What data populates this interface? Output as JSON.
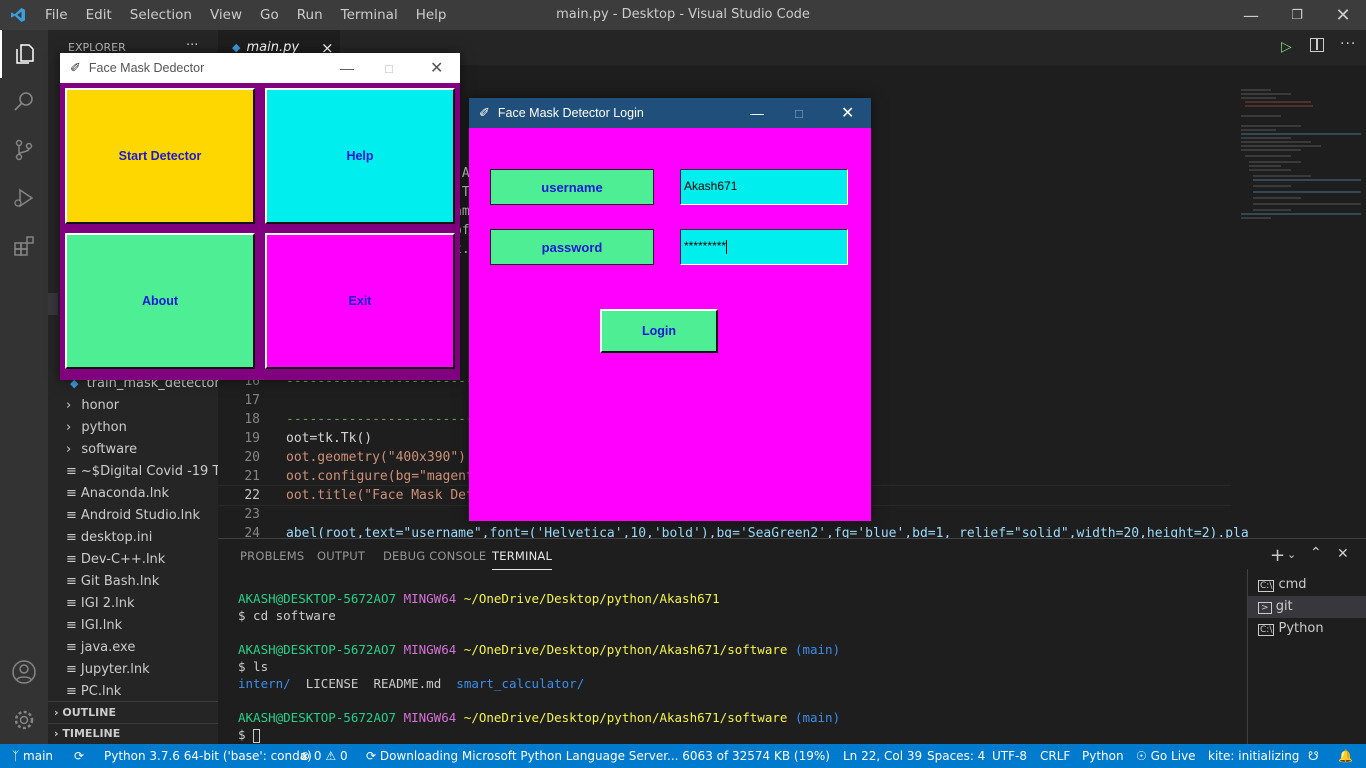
{
  "window": {
    "title": "main.py - Desktop - Visual Studio Code"
  },
  "menu": [
    "File",
    "Edit",
    "Selection",
    "View",
    "Go",
    "Run",
    "Terminal",
    "Help"
  ],
  "explorer": {
    "header": "EXPLORER",
    "more": "···"
  },
  "tab": {
    "label": "main.py",
    "close": "×"
  },
  "files": [
    {
      "label": "train_mask_detector....",
      "type": "py"
    },
    {
      "label": "honor",
      "type": "folder"
    },
    {
      "label": "python",
      "type": "folder"
    },
    {
      "label": "software",
      "type": "folder"
    },
    {
      "label": "~$Digital Covid -19 T...",
      "type": "file"
    },
    {
      "label": "Anaconda.lnk",
      "type": "file"
    },
    {
      "label": "Android Studio.lnk",
      "type": "file"
    },
    {
      "label": "desktop.ini",
      "type": "file"
    },
    {
      "label": "Dev-C++.lnk",
      "type": "file"
    },
    {
      "label": "Git Bash.lnk",
      "type": "file"
    },
    {
      "label": "IGI 2.lnk",
      "type": "file"
    },
    {
      "label": "IGI.lnk",
      "type": "file"
    },
    {
      "label": "java.exe",
      "type": "file"
    },
    {
      "label": "Jupyter.lnk",
      "type": "file"
    },
    {
      "label": "PC.lnk",
      "type": "file"
    }
  ],
  "outline": "OUTLINE",
  "timeline": "TIMELINE",
  "code_lines": [
    {
      "n": "16",
      "text": "------------------------------"
    },
    {
      "n": "17",
      "text": ""
    },
    {
      "n": "18",
      "text": "------------------------------"
    },
    {
      "n": "19",
      "text": "oot=tk.Tk()"
    },
    {
      "n": "20",
      "text": "oot.geometry(\"400x390\")"
    },
    {
      "n": "21",
      "text": "oot.configure(bg=\"magent"
    },
    {
      "n": "22",
      "text": "oot.title(\"Face Mask Det"
    },
    {
      "n": "23",
      "text": ""
    },
    {
      "n": "24",
      "text": "abel(root,text=\"username\",font=('Helvetica',10,'bold'),bg='SeaGreen2',fg='blue',bd=1, relief=\"solid\",width=20,height=2).pla"
    }
  ],
  "partial_code_fragments": [
    ":",
    "(A",
    ":T",
    "am",
    "of",
    "t."
  ],
  "panel_tabs": [
    "PROBLEMS",
    "OUTPUT",
    "DEBUG CONSOLE",
    "TERMINAL"
  ],
  "terminal": [
    {
      "user": "AKASH@DESKTOP-5672AO7",
      "env": "MINGW64",
      "path": "~/OneDrive/Desktop/python/Akash671",
      "branch": ""
    },
    {
      "cmd": "$ cd software"
    },
    {
      "user": "AKASH@DESKTOP-5672AO7",
      "env": "MINGW64",
      "path": "~/OneDrive/Desktop/python/Akash671/software",
      "branch": "(main)"
    },
    {
      "cmd": "$ ls"
    },
    {
      "ls": [
        "intern/",
        "LICENSE",
        "README.md",
        "smart_calculator/"
      ]
    },
    {
      "user": "AKASH@DESKTOP-5672AO7",
      "env": "MINGW64",
      "path": "~/OneDrive/Desktop/python/Akash671/software",
      "branch": "(main)"
    },
    {
      "cmd": "$ "
    }
  ],
  "terminal_list": [
    {
      "label": "cmd"
    },
    {
      "label": "git"
    },
    {
      "label": "Python"
    }
  ],
  "status": {
    "branch": "main",
    "python": "Python 3.7.6 64-bit ('base': conda)",
    "errors": "0",
    "warnings": "0",
    "download": "Downloading Microsoft Python Language Server... 6063 of 32574 KB (19%)",
    "position": "Ln 22, Col 39",
    "spaces": "Spaces: 4",
    "encoding": "UTF-8",
    "eol": "CRLF",
    "lang": "Python",
    "golive": "Go Live",
    "kite": "kite: initializing"
  },
  "detector_window": {
    "title": "Face Mask Dedector",
    "buttons": [
      {
        "label": "Start Detector",
        "color": "#ffd700"
      },
      {
        "label": "Help",
        "color": "#00eeee"
      },
      {
        "label": "About",
        "color": "#4eee94"
      },
      {
        "label": "Exit",
        "color": "#ff00ff"
      }
    ],
    "bg": "#800080"
  },
  "login_window": {
    "title": "Face Mask Detector Login",
    "username_label": "username",
    "password_label": "password",
    "username_value": "Akash671",
    "password_value": "*********",
    "login_button": "Login",
    "bg": "#ff00ff",
    "label_bg": "#4eee94",
    "entry_bg": "#00eeee"
  },
  "colors": {
    "accent": "#007acc",
    "titlebar": "#3c3c3c",
    "activitybar": "#333333",
    "sidebar": "#252526"
  }
}
